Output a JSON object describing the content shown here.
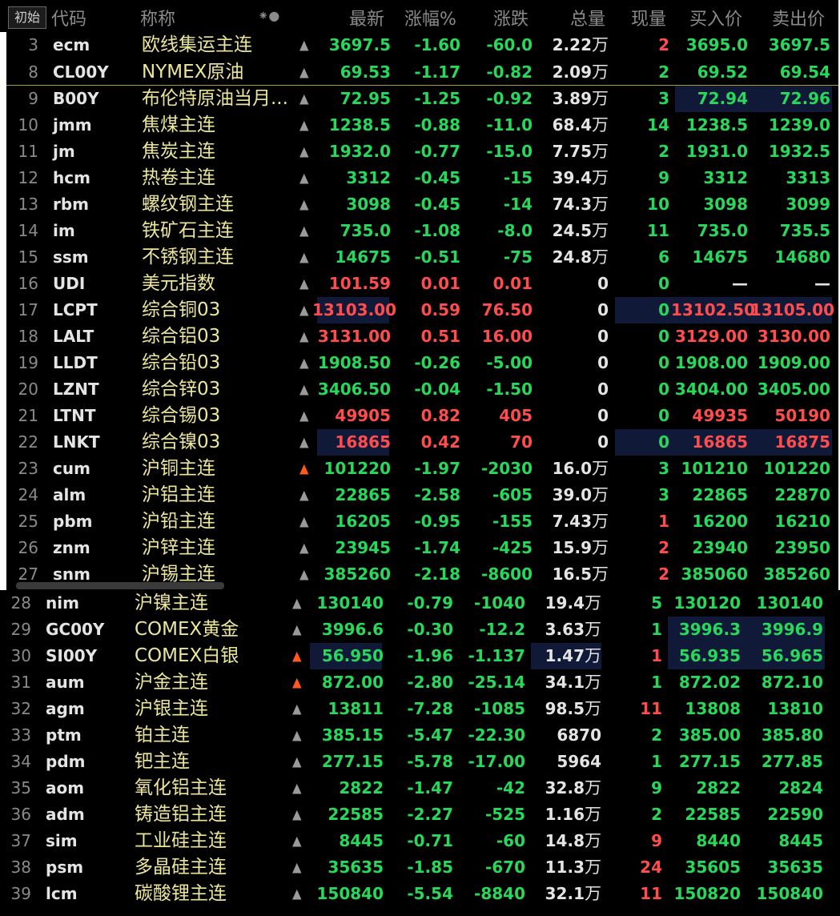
{
  "header": {
    "init_button": "初始",
    "col_code": "代码",
    "col_name": "称称",
    "col_icons": "⁕●",
    "col_last": "最新",
    "col_pct": "涨幅%",
    "col_chg": "涨跌",
    "col_vol": "总量",
    "col_cur": "现量",
    "col_bid": "买入价",
    "col_ask": "卖出价"
  },
  "colors": {
    "up": "#ff4d4d",
    "down": "#27d85b",
    "name": "#ece69a",
    "highlight": "#101a38"
  },
  "rows": [
    {
      "no": "3",
      "code": "ecm",
      "name": "欧线集运主连",
      "alert": false,
      "last": "3697.5",
      "pct": "-1.60",
      "chg": "-60.0",
      "vol": "2.22",
      "unit": "万",
      "cur": "2",
      "bid": "3695.0",
      "ask": "3697.5",
      "dir": "g",
      "cur_dir": "r"
    },
    {
      "no": "8",
      "code": "CL00Y",
      "name": "NYMEX原油",
      "alert": false,
      "last": "69.53",
      "pct": "-1.17",
      "chg": "-0.82",
      "vol": "2.09",
      "unit": "万",
      "cur": "2",
      "bid": "69.52",
      "ask": "69.54",
      "dir": "g",
      "cur_dir": "g"
    },
    {
      "no": "9",
      "code": "B00Y",
      "name": "布伦特原油当月...",
      "alert": false,
      "last": "72.95",
      "pct": "-1.25",
      "chg": "-0.92",
      "vol": "3.89",
      "unit": "万",
      "cur": "3",
      "bid": "72.94",
      "ask": "72.96",
      "dir": "g",
      "cur_dir": "g",
      "hl_bidask": true
    },
    {
      "no": "10",
      "code": "jmm",
      "name": "焦煤主连",
      "alert": false,
      "last": "1238.5",
      "pct": "-0.88",
      "chg": "-11.0",
      "vol": "68.4",
      "unit": "万",
      "cur": "14",
      "bid": "1238.5",
      "ask": "1239.0",
      "dir": "g",
      "cur_dir": "g"
    },
    {
      "no": "11",
      "code": "jm",
      "name": "焦炭主连",
      "alert": false,
      "last": "1932.0",
      "pct": "-0.77",
      "chg": "-15.0",
      "vol": "7.75",
      "unit": "万",
      "cur": "2",
      "bid": "1931.0",
      "ask": "1932.5",
      "dir": "g",
      "cur_dir": "g"
    },
    {
      "no": "12",
      "code": "hcm",
      "name": "热卷主连",
      "alert": false,
      "last": "3312",
      "pct": "-0.45",
      "chg": "-15",
      "vol": "39.4",
      "unit": "万",
      "cur": "9",
      "bid": "3312",
      "ask": "3313",
      "dir": "g",
      "cur_dir": "g"
    },
    {
      "no": "13",
      "code": "rbm",
      "name": "螺纹钢主连",
      "alert": false,
      "last": "3098",
      "pct": "-0.45",
      "chg": "-14",
      "vol": "74.3",
      "unit": "万",
      "cur": "10",
      "bid": "3098",
      "ask": "3099",
      "dir": "g",
      "cur_dir": "g"
    },
    {
      "no": "14",
      "code": "im",
      "name": "铁矿石主连",
      "alert": false,
      "last": "735.0",
      "pct": "-1.08",
      "chg": "-8.0",
      "vol": "24.5",
      "unit": "万",
      "cur": "11",
      "bid": "735.0",
      "ask": "735.5",
      "dir": "g",
      "cur_dir": "g"
    },
    {
      "no": "15",
      "code": "ssm",
      "name": "不锈钢主连",
      "alert": false,
      "last": "14675",
      "pct": "-0.51",
      "chg": "-75",
      "vol": "24.8",
      "unit": "万",
      "cur": "6",
      "bid": "14675",
      "ask": "14680",
      "dir": "g",
      "cur_dir": "g"
    },
    {
      "no": "16",
      "code": "UDI",
      "name": "美元指数",
      "alert": false,
      "last": "101.59",
      "pct": "0.01",
      "chg": "0.01",
      "vol": "0",
      "unit": "",
      "cur": "0",
      "bid": "—",
      "ask": "—",
      "dir": "r",
      "cur_dir": "g",
      "dash": true
    },
    {
      "no": "17",
      "code": "LCPT",
      "name": "综合铜03",
      "alert": false,
      "last": "13103.00",
      "pct": "0.59",
      "chg": "76.50",
      "vol": "0",
      "unit": "",
      "cur": "0",
      "bid": "13102.50",
      "ask": "13105.00",
      "dir": "r",
      "cur_dir": "g",
      "hl_last": true,
      "hl_curask": true
    },
    {
      "no": "18",
      "code": "LALT",
      "name": "综合铝03",
      "alert": false,
      "last": "3131.00",
      "pct": "0.51",
      "chg": "16.00",
      "vol": "0",
      "unit": "",
      "cur": "0",
      "bid": "3129.00",
      "ask": "3130.00",
      "dir": "r",
      "cur_dir": "g"
    },
    {
      "no": "19",
      "code": "LLDT",
      "name": "综合铅03",
      "alert": false,
      "last": "1908.50",
      "pct": "-0.26",
      "chg": "-5.00",
      "vol": "0",
      "unit": "",
      "cur": "0",
      "bid": "1908.00",
      "ask": "1909.00",
      "dir": "g",
      "cur_dir": "g"
    },
    {
      "no": "20",
      "code": "LZNT",
      "name": "综合锌03",
      "alert": false,
      "last": "3406.50",
      "pct": "-0.04",
      "chg": "-1.50",
      "vol": "0",
      "unit": "",
      "cur": "0",
      "bid": "3404.00",
      "ask": "3405.00",
      "dir": "g",
      "cur_dir": "g"
    },
    {
      "no": "21",
      "code": "LTNT",
      "name": "综合锡03",
      "alert": false,
      "last": "49905",
      "pct": "0.82",
      "chg": "405",
      "vol": "0",
      "unit": "",
      "cur": "0",
      "bid": "49935",
      "ask": "50190",
      "dir": "r",
      "cur_dir": "g"
    },
    {
      "no": "22",
      "code": "LNKT",
      "name": "综合镍03",
      "alert": false,
      "last": "16865",
      "pct": "0.42",
      "chg": "70",
      "vol": "0",
      "unit": "",
      "cur": "0",
      "bid": "16865",
      "ask": "16875",
      "dir": "r",
      "cur_dir": "g",
      "hl_last": true,
      "hl_curask": true
    },
    {
      "no": "23",
      "code": "cum",
      "name": "沪铜主连",
      "alert": true,
      "last": "101220",
      "pct": "-1.97",
      "chg": "-2030",
      "vol": "16.0",
      "unit": "万",
      "cur": "3",
      "bid": "101210",
      "ask": "101220",
      "dir": "g",
      "cur_dir": "g"
    },
    {
      "no": "24",
      "code": "alm",
      "name": "沪铝主连",
      "alert": false,
      "last": "22865",
      "pct": "-2.58",
      "chg": "-605",
      "vol": "39.0",
      "unit": "万",
      "cur": "3",
      "bid": "22865",
      "ask": "22870",
      "dir": "g",
      "cur_dir": "g"
    },
    {
      "no": "25",
      "code": "pbm",
      "name": "沪铅主连",
      "alert": false,
      "last": "16205",
      "pct": "-0.95",
      "chg": "-155",
      "vol": "7.43",
      "unit": "万",
      "cur": "1",
      "bid": "16200",
      "ask": "16210",
      "dir": "g",
      "cur_dir": "r"
    },
    {
      "no": "26",
      "code": "znm",
      "name": "沪锌主连",
      "alert": false,
      "last": "23945",
      "pct": "-1.74",
      "chg": "-425",
      "vol": "15.9",
      "unit": "万",
      "cur": "2",
      "bid": "23940",
      "ask": "23950",
      "dir": "g",
      "cur_dir": "r"
    },
    {
      "no": "27",
      "code": "snm",
      "name": "沪锡主连",
      "alert": false,
      "last": "385260",
      "pct": "-2.18",
      "chg": "-8600",
      "vol": "16.5",
      "unit": "万",
      "cur": "2",
      "bid": "385060",
      "ask": "385260",
      "dir": "g",
      "cur_dir": "r"
    },
    {
      "no": "28",
      "code": "nim",
      "name": "沪镍主连",
      "alert": false,
      "last": "130140",
      "pct": "-0.79",
      "chg": "-1040",
      "vol": "19.4",
      "unit": "万",
      "cur": "5",
      "bid": "130120",
      "ask": "130140",
      "dir": "g",
      "cur_dir": "g"
    },
    {
      "no": "29",
      "code": "GC00Y",
      "name": "COMEX黄金",
      "alert": false,
      "last": "3996.6",
      "pct": "-0.30",
      "chg": "-12.2",
      "vol": "3.63",
      "unit": "万",
      "cur": "1",
      "bid": "3996.3",
      "ask": "3996.9",
      "dir": "g",
      "cur_dir": "g",
      "hl_bidask": true
    },
    {
      "no": "30",
      "code": "SI00Y",
      "name": "COMEX白银",
      "alert": true,
      "last": "56.950",
      "pct": "-1.96",
      "chg": "-1.137",
      "vol": "1.47",
      "unit": "万",
      "cur": "1",
      "bid": "56.935",
      "ask": "56.965",
      "dir": "g",
      "cur_dir": "r",
      "hl_last": true,
      "hl_vol": true,
      "hl_bidask": true
    },
    {
      "no": "31",
      "code": "aum",
      "name": "沪金主连",
      "alert": true,
      "last": "872.00",
      "pct": "-2.80",
      "chg": "-25.14",
      "vol": "34.1",
      "unit": "万",
      "cur": "1",
      "bid": "872.02",
      "ask": "872.10",
      "dir": "g",
      "cur_dir": "g"
    },
    {
      "no": "32",
      "code": "agm",
      "name": "沪银主连",
      "alert": false,
      "last": "13811",
      "pct": "-7.28",
      "chg": "-1085",
      "vol": "98.5",
      "unit": "万",
      "cur": "11",
      "bid": "13808",
      "ask": "13810",
      "dir": "g",
      "cur_dir": "r"
    },
    {
      "no": "33",
      "code": "ptm",
      "name": "铂主连",
      "alert": false,
      "last": "385.15",
      "pct": "-5.47",
      "chg": "-22.30",
      "vol": "6870",
      "unit": "",
      "cur": "2",
      "bid": "385.00",
      "ask": "385.80",
      "dir": "g",
      "cur_dir": "g"
    },
    {
      "no": "34",
      "code": "pdm",
      "name": "钯主连",
      "alert": false,
      "last": "277.15",
      "pct": "-5.78",
      "chg": "-17.00",
      "vol": "5964",
      "unit": "",
      "cur": "1",
      "bid": "277.15",
      "ask": "277.85",
      "dir": "g",
      "cur_dir": "g"
    },
    {
      "no": "35",
      "code": "aom",
      "name": "氧化铝主连",
      "alert": false,
      "last": "2822",
      "pct": "-1.47",
      "chg": "-42",
      "vol": "32.8",
      "unit": "万",
      "cur": "9",
      "bid": "2822",
      "ask": "2824",
      "dir": "g",
      "cur_dir": "g"
    },
    {
      "no": "36",
      "code": "adm",
      "name": "铸造铝主连",
      "alert": false,
      "last": "22585",
      "pct": "-2.27",
      "chg": "-525",
      "vol": "1.16",
      "unit": "万",
      "cur": "2",
      "bid": "22585",
      "ask": "22590",
      "dir": "g",
      "cur_dir": "g"
    },
    {
      "no": "37",
      "code": "sim",
      "name": "工业硅主连",
      "alert": false,
      "last": "8445",
      "pct": "-0.71",
      "chg": "-60",
      "vol": "14.8",
      "unit": "万",
      "cur": "9",
      "bid": "8440",
      "ask": "8445",
      "dir": "g",
      "cur_dir": "r"
    },
    {
      "no": "38",
      "code": "psm",
      "name": "多晶硅主连",
      "alert": false,
      "last": "35635",
      "pct": "-1.85",
      "chg": "-670",
      "vol": "11.3",
      "unit": "万",
      "cur": "24",
      "bid": "35605",
      "ask": "35635",
      "dir": "g",
      "cur_dir": "r"
    },
    {
      "no": "39",
      "code": "lcm",
      "name": "碳酸锂主连",
      "alert": false,
      "last": "150840",
      "pct": "-5.54",
      "chg": "-8840",
      "vol": "32.1",
      "unit": "万",
      "cur": "11",
      "bid": "150820",
      "ask": "150840",
      "dir": "g",
      "cur_dir": "r"
    }
  ]
}
